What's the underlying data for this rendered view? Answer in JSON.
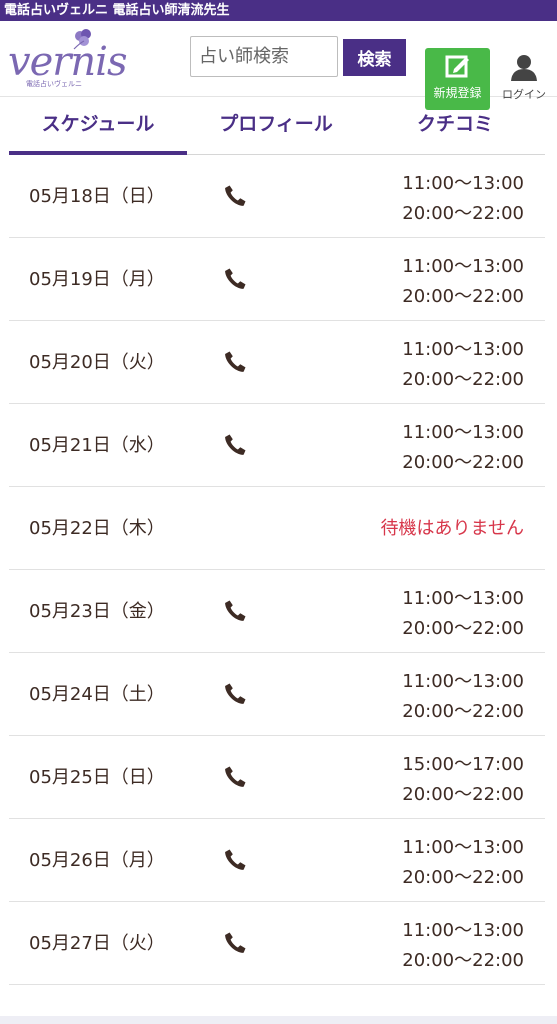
{
  "topbar": {
    "title": "電話占いヴェルニ 電話占い師清流先生"
  },
  "header": {
    "logo_text": "vernis",
    "logo_sub": "電話占いヴェルニ",
    "search_placeholder": "占い師検索",
    "search_button": "検索",
    "register_label": "新規登録",
    "login_label": "ログイン"
  },
  "tabs": [
    {
      "label": "スケジュール",
      "active": true
    },
    {
      "label": "プロフィール",
      "active": false
    },
    {
      "label": "クチコミ",
      "active": false
    }
  ],
  "schedule": [
    {
      "date": "05月18日（日）",
      "times": [
        "11:00〜13:00",
        "20:00〜22:00"
      ]
    },
    {
      "date": "05月19日（月）",
      "times": [
        "11:00〜13:00",
        "20:00〜22:00"
      ]
    },
    {
      "date": "05月20日（火）",
      "times": [
        "11:00〜13:00",
        "20:00〜22:00"
      ]
    },
    {
      "date": "05月21日（水）",
      "times": [
        "11:00〜13:00",
        "20:00〜22:00"
      ]
    },
    {
      "date": "05月22日（木）",
      "notice": "待機はありません"
    },
    {
      "date": "05月23日（金）",
      "times": [
        "11:00〜13:00",
        "20:00〜22:00"
      ]
    },
    {
      "date": "05月24日（土）",
      "times": [
        "11:00〜13:00",
        "20:00〜22:00"
      ]
    },
    {
      "date": "05月25日（日）",
      "times": [
        "15:00〜17:00",
        "20:00〜22:00"
      ]
    },
    {
      "date": "05月26日（月）",
      "times": [
        "11:00〜13:00",
        "20:00〜22:00"
      ]
    },
    {
      "date": "05月27日（火）",
      "times": [
        "11:00〜13:00",
        "20:00〜22:00"
      ]
    }
  ],
  "icons": {
    "phone": "phone-icon",
    "register": "edit-icon",
    "login": "user-icon",
    "logo": "flower-icon"
  },
  "colors": {
    "brand": "#4a2f86",
    "register_green": "#49b948",
    "notice_red": "#d7364a",
    "text": "#3d2b24"
  }
}
